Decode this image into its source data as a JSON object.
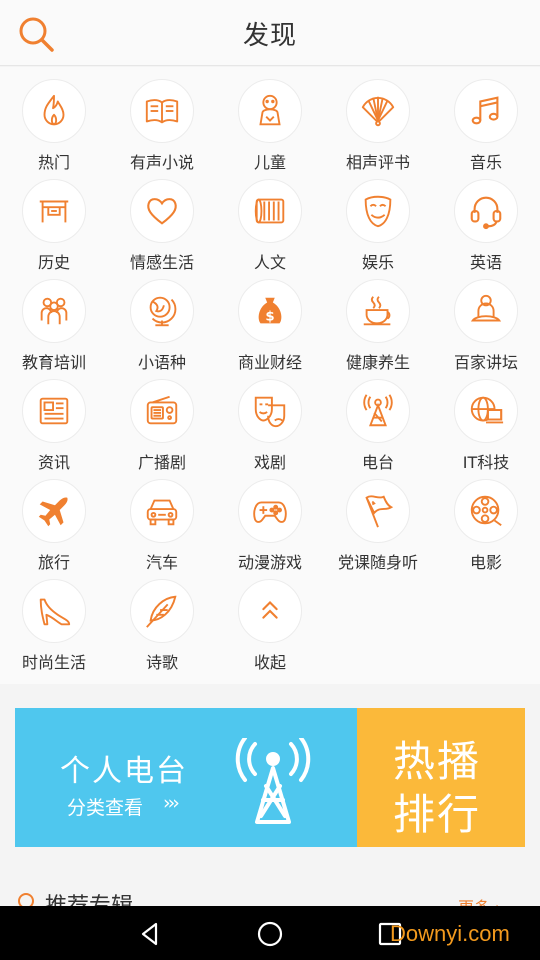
{
  "header": {
    "title": "发现"
  },
  "categories": [
    {
      "label": "热门",
      "icon": "flame-icon"
    },
    {
      "label": "有声小说",
      "icon": "book-icon"
    },
    {
      "label": "儿童",
      "icon": "baby-icon"
    },
    {
      "label": "相声评书",
      "icon": "fan-icon"
    },
    {
      "label": "音乐",
      "icon": "music-note-icon"
    },
    {
      "label": "历史",
      "icon": "ancient-gate-icon"
    },
    {
      "label": "情感生活",
      "icon": "heart-icon"
    },
    {
      "label": "人文",
      "icon": "scroll-icon"
    },
    {
      "label": "娱乐",
      "icon": "mask-icon"
    },
    {
      "label": "英语",
      "icon": "headset-icon"
    },
    {
      "label": "教育培训",
      "icon": "people-group-icon"
    },
    {
      "label": "小语种",
      "icon": "globe-icon"
    },
    {
      "label": "商业财经",
      "icon": "money-bag-icon"
    },
    {
      "label": "健康养生",
      "icon": "tea-cup-icon"
    },
    {
      "label": "百家讲坛",
      "icon": "lecturer-icon"
    },
    {
      "label": "资讯",
      "icon": "newspaper-icon"
    },
    {
      "label": "广播剧",
      "icon": "radio-icon"
    },
    {
      "label": "戏剧",
      "icon": "theater-masks-icon"
    },
    {
      "label": "电台",
      "icon": "broadcast-tower-icon"
    },
    {
      "label": "IT科技",
      "icon": "tech-globe-icon"
    },
    {
      "label": "旅行",
      "icon": "airplane-icon"
    },
    {
      "label": "汽车",
      "icon": "car-icon"
    },
    {
      "label": "动漫游戏",
      "icon": "gamepad-icon"
    },
    {
      "label": "党课随身听",
      "icon": "flag-icon"
    },
    {
      "label": "电影",
      "icon": "film-reel-icon"
    },
    {
      "label": "时尚生活",
      "icon": "high-heel-icon"
    },
    {
      "label": "诗歌",
      "icon": "feather-icon"
    },
    {
      "label": "收起",
      "icon": "collapse-icon"
    }
  ],
  "banner": {
    "left_title": "个人电台",
    "left_sub": "分类查看",
    "left_arrows": "›››",
    "right_line1": "热播",
    "right_line2": "排行"
  },
  "section": {
    "title": "推荐专辑",
    "more": "更多 ›"
  },
  "watermark": "Downyi.com",
  "colors": {
    "accent": "#f08030",
    "banner_blue": "#4fc7ee",
    "banner_orange": "#fbb93a"
  }
}
